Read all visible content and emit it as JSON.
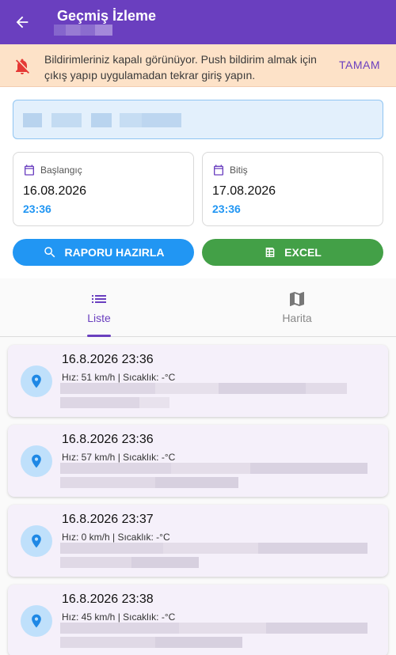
{
  "appbar": {
    "title": "Geçmiş İzleme"
  },
  "banner": {
    "message": "Bildirimleriniz kapalı görünüyor. Push bildirim almak için çıkış yapıp uygulamadan tekrar giriş yapın.",
    "ok_label": "TAMAM",
    "icon": "notifications-off-icon"
  },
  "date_range": {
    "start": {
      "label": "Başlangıç",
      "date": "16.08.2026",
      "time": "23:36"
    },
    "end": {
      "label": "Bitiş",
      "date": "17.08.2026",
      "time": "23:36"
    }
  },
  "actions": {
    "report_label": "RAPORU HAZIRLA",
    "excel_label": "EXCEL"
  },
  "tabs": [
    {
      "label": "Liste",
      "icon": "list-icon",
      "active": true
    },
    {
      "label": "Harita",
      "icon": "map-icon",
      "active": false
    }
  ],
  "records": [
    {
      "datetime": "16.8.2026 23:36",
      "info": "Hız: 51 km/h | Sıcaklık: -°C"
    },
    {
      "datetime": "16.8.2026 23:36",
      "info": "Hız: 57 km/h | Sıcaklık: -°C"
    },
    {
      "datetime": "16.8.2026 23:37",
      "info": "Hız: 0 km/h | Sıcaklık: -°C"
    },
    {
      "datetime": "16.8.2026 23:38",
      "info": "Hız: 45 km/h | Sıcaklık: -°C"
    }
  ],
  "colors": {
    "primary": "#6a3fbf",
    "accent_blue": "#2196f3",
    "accent_green": "#43a047",
    "banner_bg": "#fde2c8"
  }
}
